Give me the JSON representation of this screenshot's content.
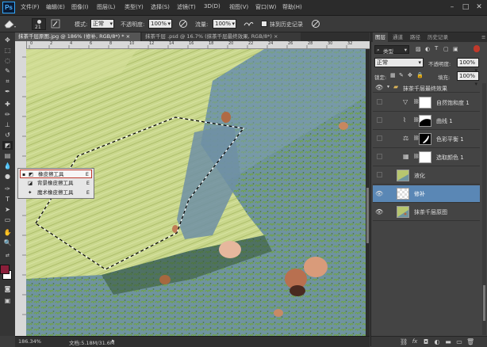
{
  "app": {
    "logo": "Ps"
  },
  "menu": [
    "文件(F)",
    "编辑(E)",
    "图像(I)",
    "图层(L)",
    "类型(Y)",
    "选择(S)",
    "滤镜(T)",
    "3D(D)",
    "视图(V)",
    "窗口(W)",
    "帮助(H)"
  ],
  "window_controls": {
    "minimize": "–",
    "maximize": "□",
    "close": "✕"
  },
  "options": {
    "brush_size": "21",
    "mode_label": "模式:",
    "mode_value": "正常",
    "opacity_label": "不透明度:",
    "opacity_value": "100%",
    "flow_label": "流量:",
    "flow_value": "100%",
    "history_label": "抹到历史记录"
  },
  "tabs": [
    {
      "label": "抹茶千层原图.jpg @ 186% (修补, RGB/8*) *",
      "close": "×",
      "active": true
    },
    {
      "label": "抹茶千层 .psd @ 16.7% (抹茶千层最终效果, RGB/8*)",
      "close": "×",
      "active": false
    }
  ],
  "ruler_numbers": [
    "0",
    "2",
    "4",
    "6",
    "8",
    "10",
    "12",
    "14",
    "16",
    "18",
    "20",
    "22",
    "24",
    "26",
    "28",
    "30",
    "32"
  ],
  "flyout": [
    {
      "label": "橡皮擦工具",
      "key": "E",
      "selected": true
    },
    {
      "label": "背景橡皮擦工具",
      "key": "E",
      "selected": false
    },
    {
      "label": "魔术橡皮擦工具",
      "key": "E",
      "selected": false
    }
  ],
  "status": {
    "zoom": "186.34%",
    "doc": "文档:5.18M/31.6M"
  },
  "panel": {
    "tabs": [
      "图层",
      "通道",
      "路径",
      "历史记录"
    ],
    "kind_value": "类型",
    "blend_mode": "正常",
    "opacity_label": "不透明度:",
    "opacity_value": "100%",
    "lock_label": "锁定:",
    "fill_label": "填充:",
    "fill_value": "100%",
    "group_name": "抹茶千层最终效果",
    "layers": [
      {
        "name": "自然饱和度 1",
        "icon": "▽",
        "visible": false
      },
      {
        "name": "曲线 1",
        "icon": "⌇",
        "visible": false
      },
      {
        "name": "色彩平衡 1",
        "icon": "⚖",
        "visible": false
      },
      {
        "name": "选取颜色 1",
        "icon": "▦",
        "visible": false
      },
      {
        "name": "液化",
        "icon": "",
        "visible": false
      },
      {
        "name": "修补",
        "icon": "",
        "visible": true,
        "selected": true
      },
      {
        "name": "抹茶千层原图",
        "icon": "",
        "visible": true
      }
    ]
  },
  "colors": {
    "foreground": "#8a1f3a",
    "background": "#ffffff",
    "selected_layer": "#5a87b5",
    "flyout_highlight": "#c0392b"
  }
}
